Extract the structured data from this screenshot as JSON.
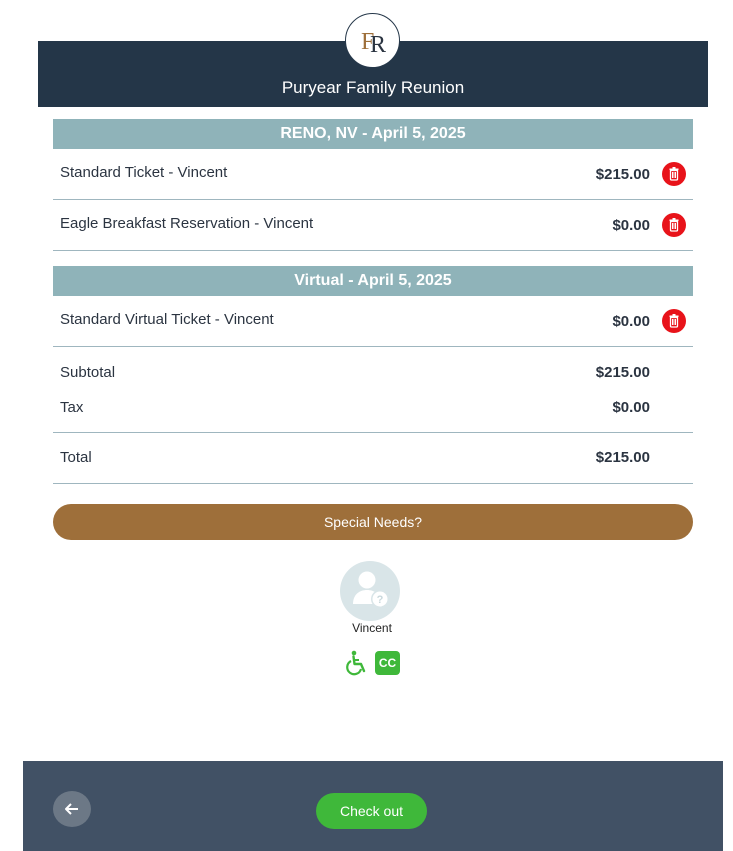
{
  "header": {
    "title": "Puryear Family Reunion",
    "logo_text": "FR",
    "logo_icon": "fr-monogram-icon"
  },
  "sections": [
    {
      "title": "RENO, NV - April 5, 2025",
      "items": [
        {
          "name": "Standard Ticket  - Vincent",
          "price": "$215.00"
        },
        {
          "name": "Eagle Breakfast Reservation  - Vincent",
          "price": "$0.00"
        }
      ]
    },
    {
      "title": "Virtual - April 5, 2025",
      "items": [
        {
          "name": "Standard Virtual Ticket  - Vincent",
          "price": "$0.00"
        }
      ]
    }
  ],
  "summary": {
    "subtotal_label": "Subtotal",
    "subtotal_value": "$215.00",
    "tax_label": "Tax",
    "tax_value": "$0.00",
    "total_label": "Total",
    "total_value": "$215.00"
  },
  "special_needs": {
    "label": "Special Needs?"
  },
  "attendee": {
    "name": "Vincent",
    "avatar_icon": "user-question-icon",
    "badges": [
      {
        "icon": "wheelchair-icon"
      },
      {
        "label": "CC"
      }
    ]
  },
  "footer": {
    "back_icon": "arrow-left-icon",
    "checkout_label": "Check out"
  },
  "colors": {
    "header_bg": "#243648",
    "section_bg": "#8fb3b9",
    "delete_red": "#e8131a",
    "special_btn": "#9e6f3a",
    "accent_green": "#3fb83a",
    "footer_bg": "#415165"
  }
}
